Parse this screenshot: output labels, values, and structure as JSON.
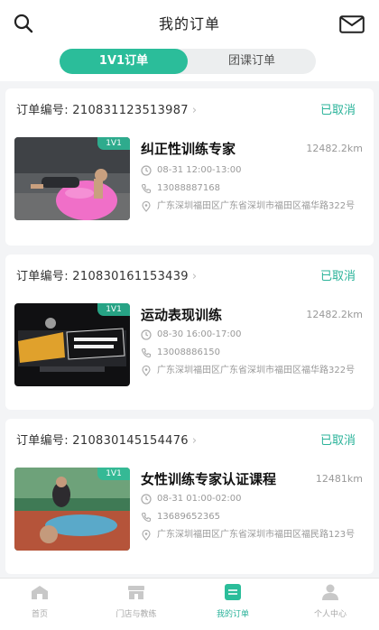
{
  "header": {
    "title": "我的订单",
    "search_icon": "search-icon",
    "mail_icon": "mail-icon"
  },
  "tabs": [
    {
      "label": "1V1订单",
      "active": true
    },
    {
      "label": "团课订单",
      "active": false
    }
  ],
  "orders": [
    {
      "order_no": "订单编号: 210831123513987",
      "status": "已取消",
      "badge": "1V1",
      "title": "纠正性训练专家",
      "distance": "12482.2km",
      "time": "08-31 12:00-13:00",
      "phone": "13088887168",
      "address": "广东深圳福田区广东省深圳市福田区福华路322号"
    },
    {
      "order_no": "订单编号: 210830161153439",
      "status": "已取消",
      "badge": "1V1",
      "title": "运动表现训练",
      "distance": "12482.2km",
      "time": "08-30 16:00-17:00",
      "phone": "13008886150",
      "address": "广东深圳福田区广东省深圳市福田区福华路322号"
    },
    {
      "order_no": "订单编号: 210830145154476",
      "status": "已取消",
      "badge": "1V1",
      "title": "女性训练专家认证课程",
      "distance": "12481km",
      "time": "08-31 01:00-02:00",
      "phone": "13689652365",
      "address": "广东深圳福田区广东省深圳市福田区福民路123号"
    }
  ],
  "tabbar": [
    {
      "label": "首页",
      "icon": "home-icon",
      "active": false
    },
    {
      "label": "门店与教练",
      "icon": "store-icon",
      "active": false
    },
    {
      "label": "我的订单",
      "icon": "orders-icon",
      "active": true
    },
    {
      "label": "个人中心",
      "icon": "profile-icon",
      "active": false
    }
  ],
  "colors": {
    "accent": "#2bbd9a",
    "status": "#2bb39a",
    "background": "#f3f4f6"
  }
}
